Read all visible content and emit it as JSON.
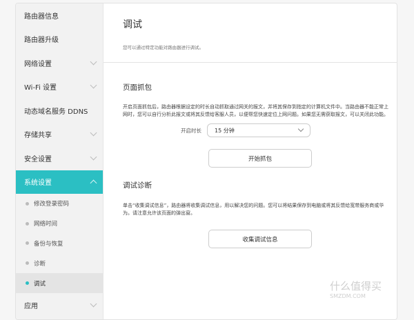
{
  "sidebar": {
    "items": [
      {
        "label": "路由器信息"
      },
      {
        "label": "路由器升级"
      },
      {
        "label": "网络设置"
      },
      {
        "label": "Wi-Fi 设置"
      },
      {
        "label": "动态域名服务 DDNS"
      },
      {
        "label": "存储共享"
      },
      {
        "label": "安全设置"
      },
      {
        "label": "系统设置"
      }
    ],
    "sub_items": [
      {
        "label": "修改登录密码"
      },
      {
        "label": "网络时间"
      },
      {
        "label": "备份与恢复"
      },
      {
        "label": "诊断"
      },
      {
        "label": "调试"
      }
    ],
    "after": {
      "label": "应用"
    }
  },
  "header": {
    "title": "调试",
    "description": "您可以通过特定功能对路由器进行调试。"
  },
  "capture": {
    "title": "页面抓包",
    "description": "开启页面抓包后，路由器根据设定的时长自动抓取通过网关的报文，并将其保存到指定的计算机文件中。当路由器不能正常上网时，您可以自行分析此报文或将其反馈给客服人员，以便帮您快速定位上网问题。如果您无需获取报文，可以关闭此功能。",
    "duration_label": "开启时长",
    "duration_value": "15 分钟",
    "start_button": "开始抓包"
  },
  "diag": {
    "title": "调试诊断",
    "description": "单击“收集调试信息”，路由器将收集调试信息，用以解决您的问题。您可以将结果保存到电脑或将其反馈给宽带服务商或华为。请注意允许该页面的弹出窗。",
    "collect_button": "收集调试信息"
  },
  "watermark": {
    "text": "什么值得买",
    "url": "SMZDM.COM"
  }
}
